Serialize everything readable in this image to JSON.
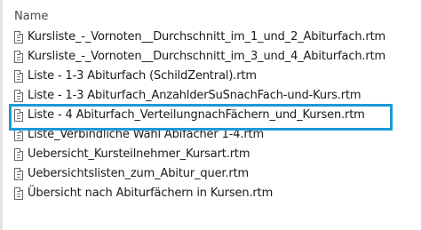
{
  "header": {
    "column_name": "Name"
  },
  "files": [
    {
      "icon": "document-icon",
      "name": "Kursliste_-_Vornoten__Durchschnitt_im_1_und_2_Abiturfach.rtm"
    },
    {
      "icon": "document-icon",
      "name": "Kursliste_-_Vornoten__Durchschnitt_im_3_und_4_Abiturfach.rtm"
    },
    {
      "icon": "document-icon",
      "name": "Liste - 1-3 Abiturfach (SchildZentral).rtm"
    },
    {
      "icon": "document-icon",
      "name": "Liste - 1-3 Abiturfach_AnzahlderSuSnachFach-und-Kurs.rtm"
    },
    {
      "icon": "document-icon",
      "name": "Liste - 4 Abiturfach_VerteilungnachFächern_und_Kursen.rtm"
    },
    {
      "icon": "document-icon",
      "name": "Liste_Verbindliche Wahl Abifächer 1-4.rtm"
    },
    {
      "icon": "document-icon",
      "name": "Uebersicht_Kursteilnehmer_Kursart.rtm"
    },
    {
      "icon": "document-icon",
      "name": "Uebersichtslisten_zum_Abitur_quer.rtm"
    },
    {
      "icon": "document-icon",
      "name": "Übersicht nach Abiturfächern in Kursen.rtm"
    }
  ],
  "highlight": {
    "color": "#1c9ad6",
    "file_index": 4
  }
}
